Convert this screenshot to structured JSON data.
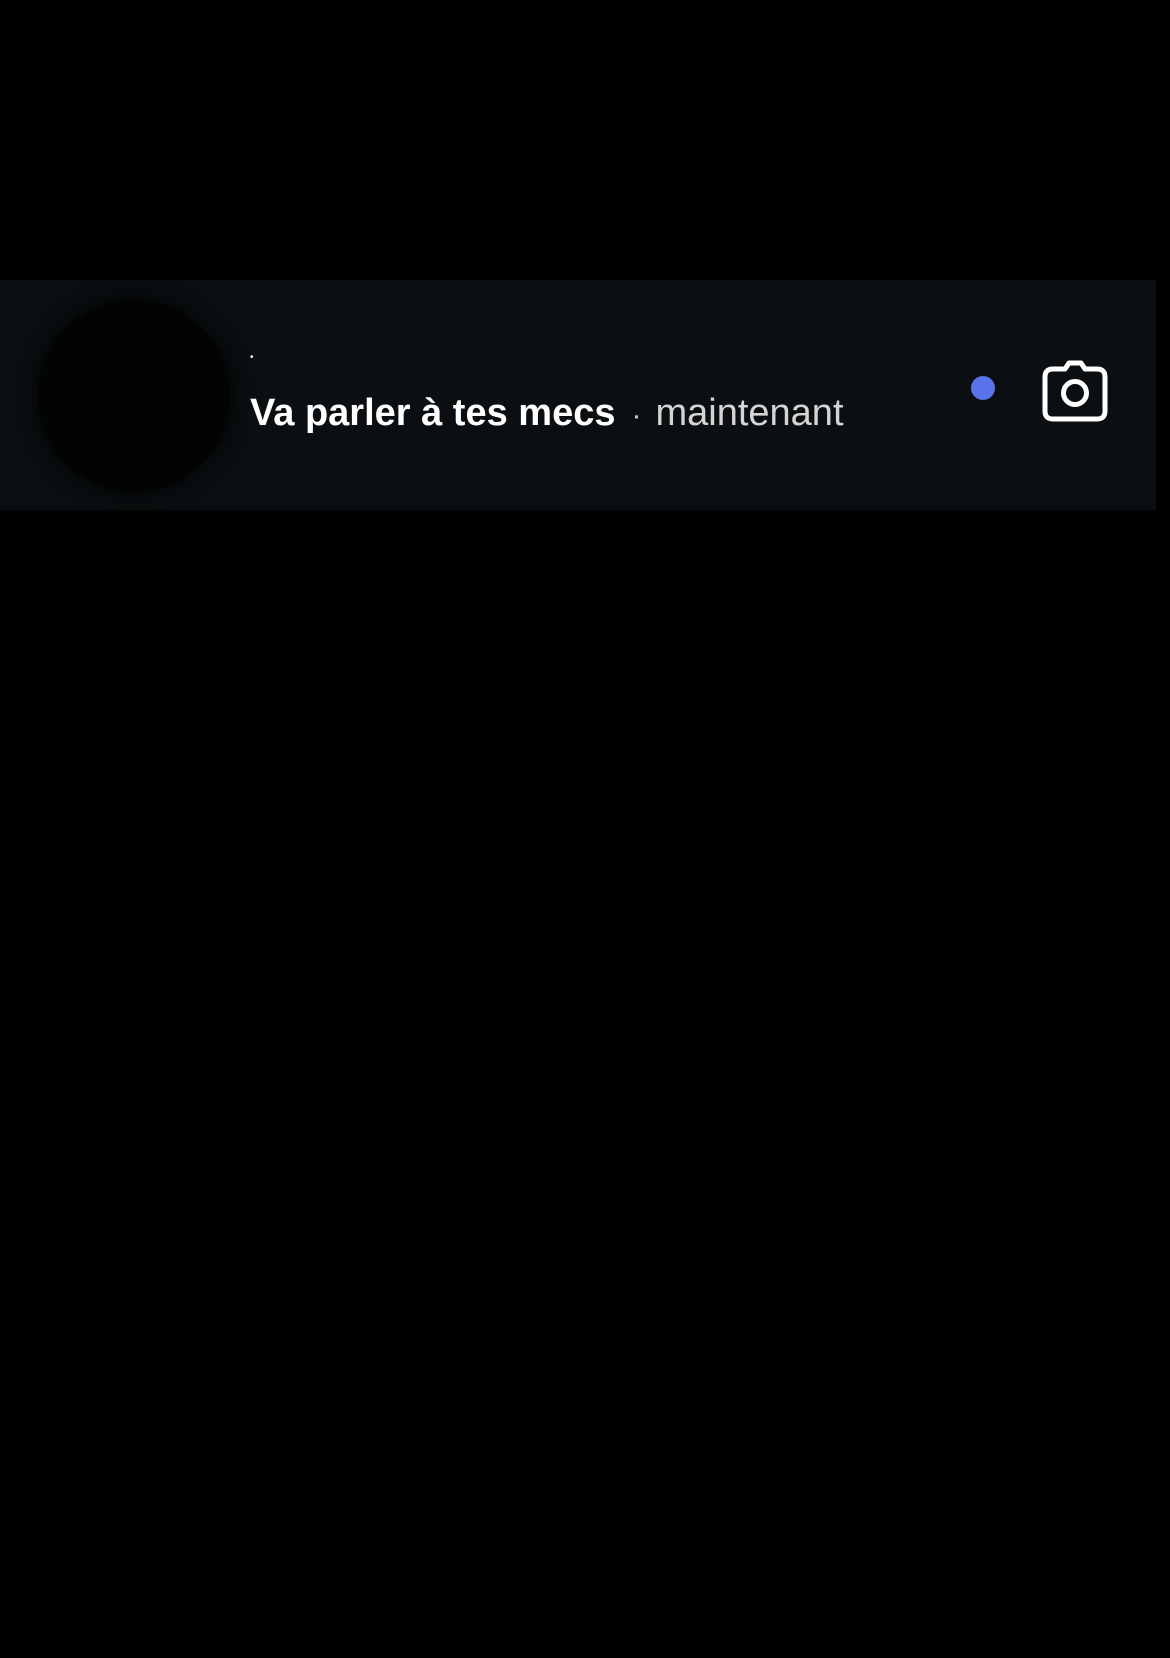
{
  "thread": {
    "name": "•",
    "message": "Va parler à tes mecs",
    "separator": "·",
    "time": "maintenant",
    "unread": true,
    "unread_color": "#5a72ea",
    "action_icon": "camera-icon"
  }
}
